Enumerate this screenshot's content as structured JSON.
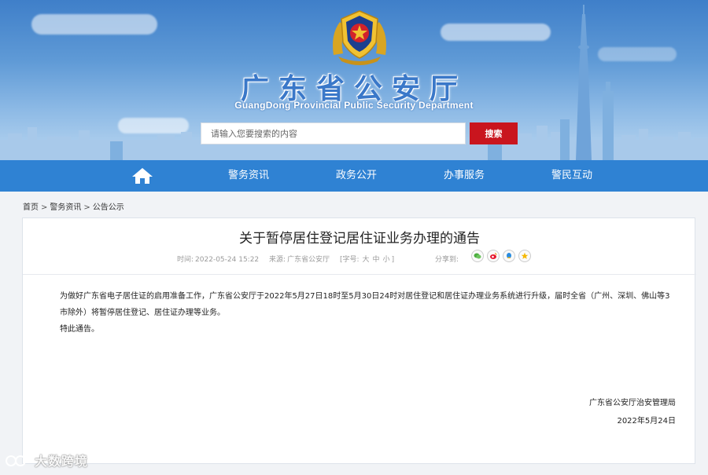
{
  "header": {
    "site_title": "广东省公安厅",
    "site_subtitle": "GuangDong Provincial Public Security Department",
    "search": {
      "placeholder": "请输入您要搜索的内容",
      "button_label": "搜索"
    }
  },
  "nav": {
    "home_icon": "home-icon",
    "items": [
      {
        "label": "警务资讯"
      },
      {
        "label": "政务公开"
      },
      {
        "label": "办事服务"
      },
      {
        "label": "警民互动"
      }
    ]
  },
  "breadcrumb": {
    "items": [
      {
        "label": "首页"
      },
      {
        "label": "警务资讯"
      },
      {
        "label": "公告公示"
      }
    ],
    "separator": ">"
  },
  "article": {
    "title": "关于暂停居住登记居住证业务办理的通告",
    "time_label": "时间:",
    "time_value": "2022-05-24 15:22",
    "source_label": "来源:",
    "source_value": "广东省公安厅",
    "font_size_label": "[字号:",
    "font_sizes": [
      "大",
      "中",
      "小"
    ],
    "font_size_close": "]",
    "share_label": "分享到:",
    "share_icons": [
      "wechat-icon",
      "weibo-icon",
      "qzone-icon",
      "favorite-icon"
    ],
    "paragraphs": [
      "为做好广东省电子居住证的启用准备工作，广东省公安厅于2022年5月27日18时至5月30日24时对居住登记和居住证办理业务系统进行升级，届时全省（广州、深圳、佛山等3市除外）将暂停居住登记、居住证办理等业务。",
      "特此通告。"
    ],
    "signature_org": "广东省公安厅治安管理局",
    "signature_date": "2022年5月24日"
  },
  "watermark": {
    "text": "大数跨境"
  },
  "colors": {
    "nav_blue": "#2f82d3",
    "search_red": "#c9151e",
    "title_blue": "#3a78c9"
  }
}
